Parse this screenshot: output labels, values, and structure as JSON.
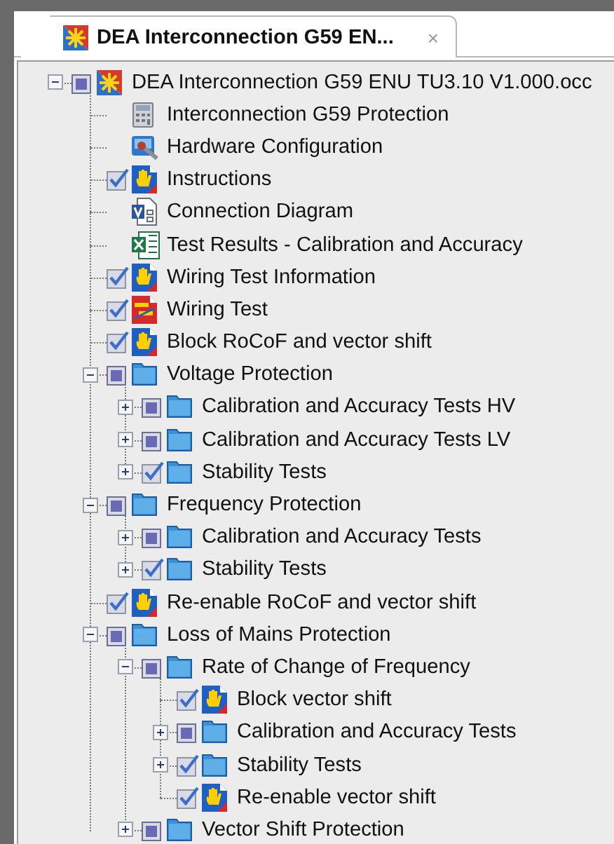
{
  "tab": {
    "title": "DEA Interconnection G59 EN...",
    "close": "×",
    "selected": true
  },
  "tree": [
    {
      "label": "DEA Interconnection G59 ENU TU3.10 V1.000.occ",
      "kind": "app",
      "checked": false,
      "indeterminate": true,
      "expanded": true,
      "children": [
        {
          "label": "Interconnection G59 Protection",
          "kind": "calculator"
        },
        {
          "label": "Hardware Configuration",
          "kind": "tools"
        },
        {
          "label": "Instructions",
          "kind": "hand",
          "checked": true,
          "indeterminate": false
        },
        {
          "label": "Connection Diagram",
          "kind": "diagram"
        },
        {
          "label": "Test Results - Calibration and Accuracy",
          "kind": "spreadsheet"
        },
        {
          "label": "Wiring Test Information",
          "kind": "hand",
          "checked": true,
          "indeterminate": false
        },
        {
          "label": "Wiring Test",
          "kind": "wiring",
          "checked": true,
          "indeterminate": false
        },
        {
          "label": "Block RoCoF and vector shift",
          "kind": "hand",
          "checked": true,
          "indeterminate": false
        },
        {
          "label": "Voltage Protection",
          "kind": "folder",
          "checked": false,
          "indeterminate": true,
          "expanded": true,
          "children": [
            {
              "label": "Calibration and Accuracy Tests HV",
              "kind": "folder",
              "checked": false,
              "indeterminate": true,
              "expanded": false
            },
            {
              "label": "Calibration and Accuracy Tests LV",
              "kind": "folder",
              "checked": false,
              "indeterminate": true,
              "expanded": false
            },
            {
              "label": "Stability Tests",
              "kind": "folder",
              "checked": true,
              "indeterminate": false,
              "expanded": false
            }
          ]
        },
        {
          "label": "Frequency Protection",
          "kind": "folder",
          "checked": false,
          "indeterminate": true,
          "expanded": true,
          "children": [
            {
              "label": "Calibration and Accuracy Tests",
              "kind": "folder",
              "checked": false,
              "indeterminate": true,
              "expanded": false
            },
            {
              "label": "Stability Tests",
              "kind": "folder",
              "checked": true,
              "indeterminate": false,
              "expanded": false
            }
          ]
        },
        {
          "label": "Re-enable RoCoF and vector shift",
          "kind": "hand",
          "checked": true,
          "indeterminate": false
        },
        {
          "label": "Loss of Mains Protection",
          "kind": "folder",
          "checked": false,
          "indeterminate": true,
          "expanded": true,
          "children": [
            {
              "label": "Rate of Change of Frequency",
              "kind": "folder",
              "checked": false,
              "indeterminate": true,
              "expanded": true,
              "children": [
                {
                  "label": "Block vector shift",
                  "kind": "hand",
                  "checked": true,
                  "indeterminate": false
                },
                {
                  "label": "Calibration and Accuracy Tests",
                  "kind": "folder",
                  "checked": false,
                  "indeterminate": true,
                  "expanded": false
                },
                {
                  "label": "Stability Tests",
                  "kind": "folder",
                  "checked": true,
                  "indeterminate": false,
                  "expanded": false
                },
                {
                  "label": "Re-enable vector shift",
                  "kind": "hand",
                  "checked": true,
                  "indeterminate": false
                }
              ]
            },
            {
              "label": "Vector Shift Protection",
              "kind": "folder",
              "checked": false,
              "indeterminate": true,
              "expanded": false
            }
          ]
        }
      ]
    }
  ]
}
